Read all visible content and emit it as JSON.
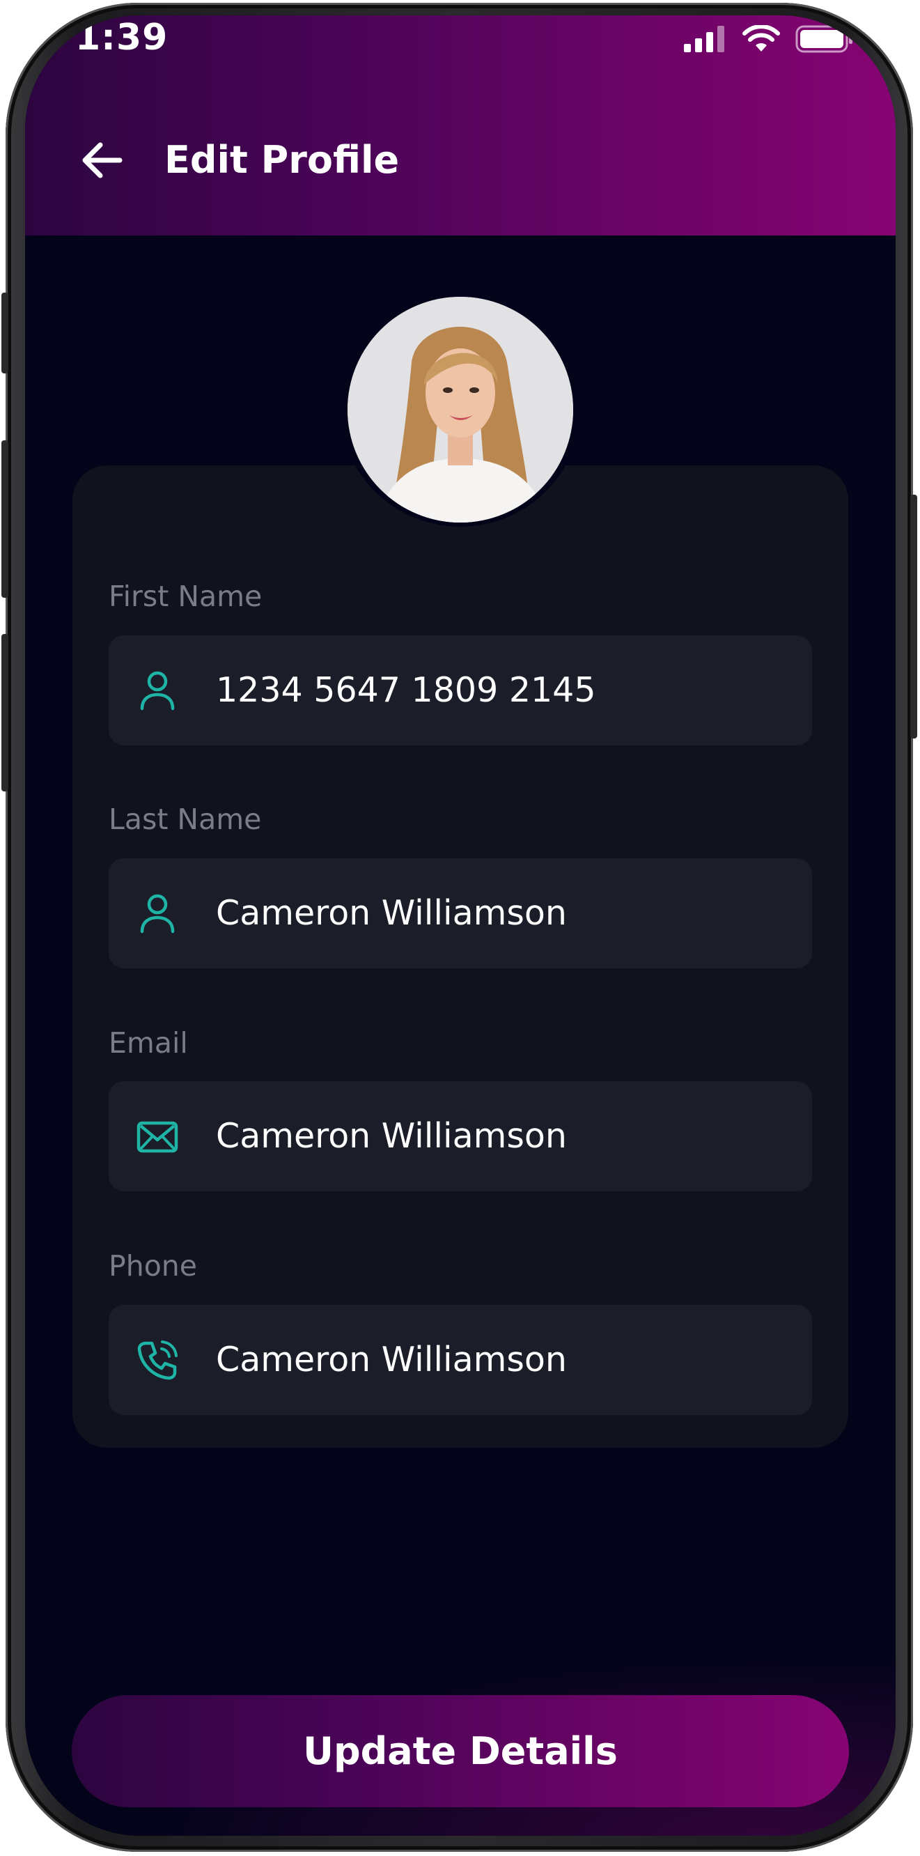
{
  "status_bar": {
    "time": "1:39",
    "icons": [
      "signal-icon",
      "wifi-icon",
      "battery-icon"
    ]
  },
  "header": {
    "title": "Edit Profile",
    "back_icon": "arrow-left-icon"
  },
  "profile": {
    "avatar": "profile-photo"
  },
  "form": {
    "fields": [
      {
        "label": "First Name",
        "value": "1234 5647 1809 2145",
        "icon": "user-icon"
      },
      {
        "label": "Last Name",
        "value": "Cameron Williamson",
        "icon": "user-icon"
      },
      {
        "label": "Email",
        "value": "Cameron Williamson",
        "icon": "mail-icon"
      },
      {
        "label": "Phone",
        "value": "Cameron Williamson",
        "icon": "phone-icon"
      }
    ]
  },
  "actions": {
    "update_label": "Update Details"
  },
  "colors": {
    "accent_start": "#2c053f",
    "accent_end": "#860473",
    "icon_teal": "#1fb5a6",
    "background": "#03041a",
    "card": "#10121d",
    "field": "#1b1e29",
    "label": "#7a7d88"
  }
}
